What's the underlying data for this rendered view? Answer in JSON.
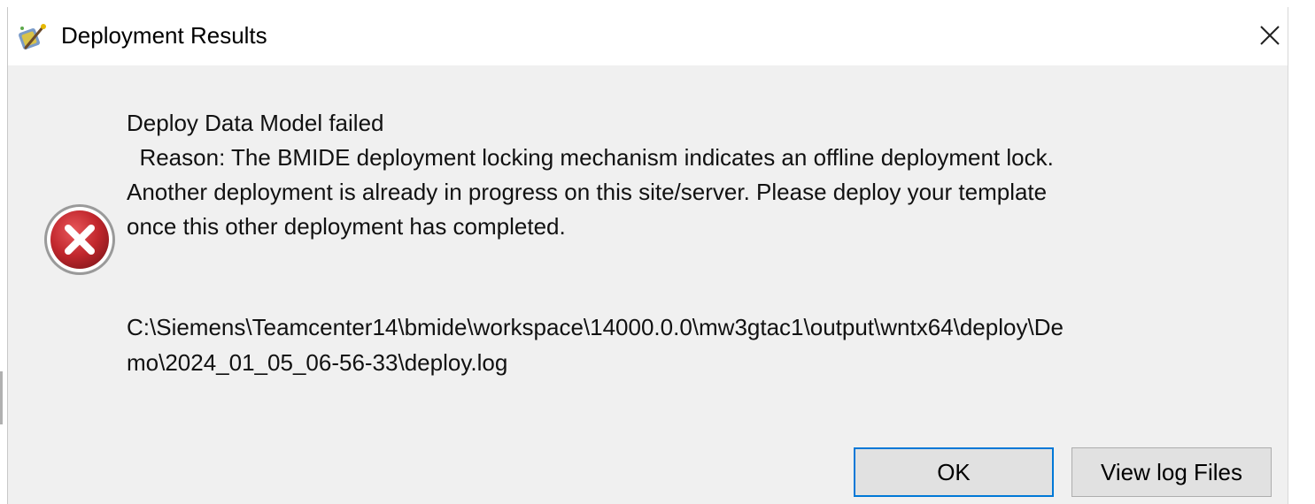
{
  "window": {
    "title": "Deployment Results",
    "app_icon": "bmide-wand-icon",
    "close_icon": "close-icon"
  },
  "message": {
    "status_icon": "error-icon",
    "lines": [
      "Deploy Data Model failed",
      "  Reason: The BMIDE deployment locking mechanism indicates an offline deployment lock.",
      "Another deployment is already in progress on this site/server. Please deploy your template",
      "once this other deployment has completed."
    ],
    "log_path_lines": [
      "C:\\Siemens\\Teamcenter14\\bmide\\workspace\\14000.0.0\\mw3gtac1\\output\\wntx64\\deploy\\De",
      "mo\\2024_01_05_06-56-33\\deploy.log"
    ]
  },
  "buttons": {
    "ok_label": "OK",
    "view_log_label": "View log Files"
  },
  "colors": {
    "dialog_bg": "#f0f0f0",
    "titlebar_bg": "#ffffff",
    "error_red": "#c1272d",
    "focus_blue": "#0078d7"
  }
}
